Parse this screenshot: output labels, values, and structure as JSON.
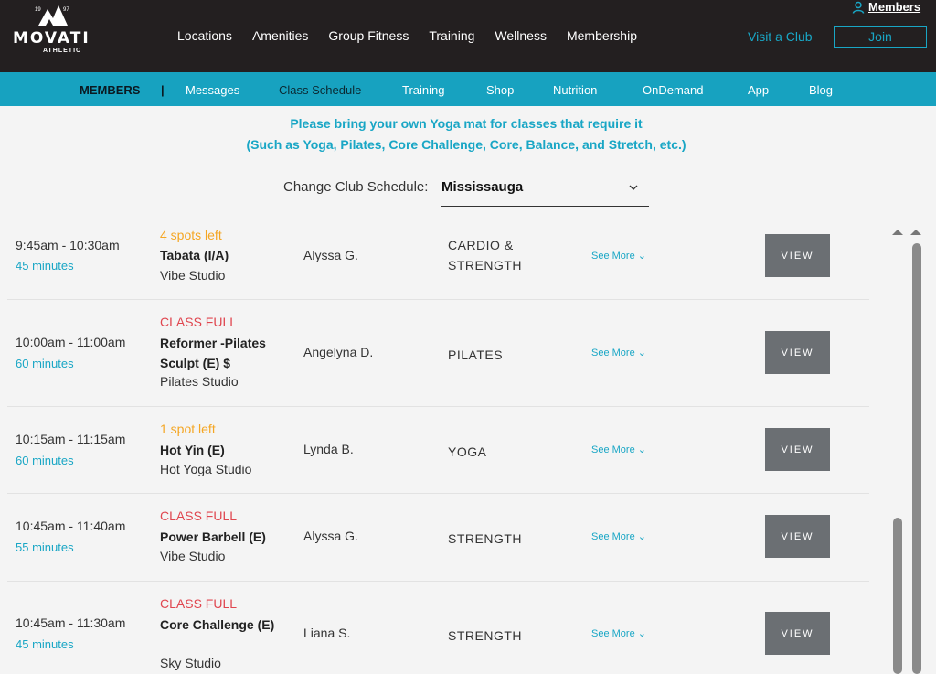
{
  "header": {
    "logo": {
      "year_left": "19",
      "year_right": "97",
      "name": "MOVATI",
      "sub": "ATHLETIC"
    },
    "nav": [
      "Locations",
      "Amenities",
      "Group Fitness",
      "Training",
      "Wellness",
      "Membership"
    ],
    "members_label": "Members",
    "visit_label": "Visit a Club",
    "join_label": "Join"
  },
  "subnav": {
    "title": "MEMBERS",
    "separator": "|",
    "items": [
      "Messages",
      "Class Schedule",
      "Training",
      "Shop",
      "Nutrition",
      "OnDemand",
      "App",
      "Blog"
    ]
  },
  "notice": {
    "line1": "Please bring your own Yoga mat for classes that require it",
    "line2": "(Such as Yoga, Pilates, Core Challenge, Core, Balance, and Stretch, etc.)"
  },
  "club": {
    "label": "Change Club Schedule:",
    "value": "Mississauga"
  },
  "classes": [
    {
      "time": "9:45am - 10:30am",
      "duration": "45 minutes",
      "status": "4 spots left",
      "name": "Tabata (I/A)",
      "studio": "Vibe Studio",
      "instructor": "Alyssa G.",
      "category": "CARDIO & STRENGTH",
      "more": "See More",
      "action": "VIEW"
    },
    {
      "time": "10:00am - 11:00am",
      "duration": "60 minutes",
      "status": "CLASS FULL",
      "name": "Reformer -Pilates Sculpt (E) $",
      "studio": "Pilates Studio",
      "instructor": "Angelyna D.",
      "category": "PILATES",
      "more": "See More",
      "action": "VIEW"
    },
    {
      "time": "10:15am - 11:15am",
      "duration": "60 minutes",
      "status": "1 spot left",
      "name": "Hot Yin (E)",
      "studio": "Hot Yoga Studio",
      "instructor": "Lynda B.",
      "category": "YOGA",
      "more": "See More",
      "action": "VIEW"
    },
    {
      "time": "10:45am - 11:40am",
      "duration": "55 minutes",
      "status": "CLASS FULL",
      "name": "Power Barbell (E)",
      "studio": "Vibe Studio",
      "instructor": "Alyssa G.",
      "category": "STRENGTH",
      "more": "See More",
      "action": "VIEW"
    },
    {
      "time": "10:45am - 11:30am",
      "duration": "45 minutes",
      "status": "CLASS FULL",
      "name": "Core Challenge (E)",
      "studio": "Sky Studio",
      "instructor": "Liana S.",
      "category": "STRENGTH",
      "more": "See More",
      "action": "VIEW"
    }
  ],
  "colors": {
    "accent": "#19a6c5",
    "full": "#e0464f",
    "spots": "#f5a623",
    "header": "#231f20",
    "view_button": "#6b6f73"
  }
}
